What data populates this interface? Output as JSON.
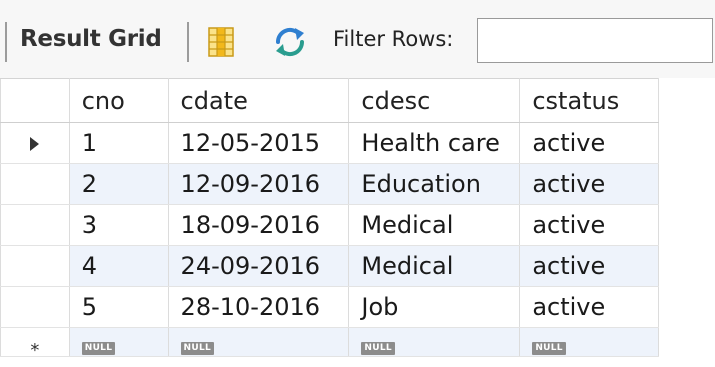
{
  "toolbar": {
    "result_grid_label": "Result Grid",
    "filter_label": "Filter Rows:",
    "filter_value": "",
    "grid_icon": "form-grid-icon",
    "refresh_icon": "refresh-icon"
  },
  "grid": {
    "columns": [
      "cno",
      "cdate",
      "cdesc",
      "cstatus"
    ],
    "rows": [
      [
        "1",
        "12-05-2015",
        "Health care",
        "active"
      ],
      [
        "2",
        "12-09-2016",
        "Education",
        "active"
      ],
      [
        "3",
        "18-09-2016",
        "Medical",
        "active"
      ],
      [
        "4",
        "24-09-2016",
        "Medical",
        "active"
      ],
      [
        "5",
        "28-10-2016",
        "Job",
        "active"
      ]
    ],
    "null_label": "NULL",
    "current_row_marker": "▶",
    "new_row_marker": "*",
    "alt_row_color": "#eef3fb"
  }
}
